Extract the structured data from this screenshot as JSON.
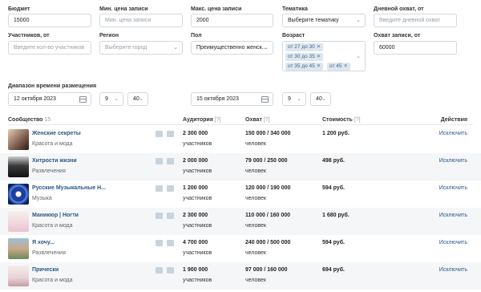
{
  "filters": {
    "budget": {
      "label": "Бюджет",
      "value": "15000"
    },
    "min_price": {
      "label": "Мин. цена записи",
      "placeholder": "Мин. цена записи"
    },
    "max_price": {
      "label": "Макс. цена записи",
      "value": "2000"
    },
    "topic": {
      "label": "Тематика",
      "value": "Выберите тематику"
    },
    "daily_reach": {
      "label": "Дневной охват, от",
      "placeholder": "Введите дневной охват"
    },
    "members": {
      "label": "Участников, от",
      "placeholder": "Введите кол-во участников"
    },
    "region": {
      "label": "Регион",
      "value": "Выберите город"
    },
    "gender": {
      "label": "Пол",
      "value": "Преимущественно женск..."
    },
    "age": {
      "label": "Возраст",
      "tags": [
        "от 27 до 30",
        "от 30 до 35",
        "от 35 до 45",
        "от 45"
      ]
    },
    "post_reach": {
      "label": "Охват записи, от",
      "value": "60000"
    }
  },
  "date_range": {
    "label": "Диапазон времени размещения",
    "from_date": "12 октября 2023",
    "from_hour": "9",
    "from_minute": "40",
    "to_date": "15 октября 2023",
    "to_hour": "9",
    "to_minute": "40"
  },
  "table": {
    "headers": {
      "community": "Сообщество",
      "community_count": "15",
      "audience": "Аудитория",
      "reach": "Охват",
      "cost": "Стоимость",
      "help": "[?]",
      "actions": "Действия"
    },
    "rows": [
      {
        "name": "Женские секреты",
        "category": "Красота и мода",
        "audience": "2 300 000",
        "audience_unit": "участников",
        "reach": "150 000 / 340 000",
        "reach_unit": "человек",
        "cost": "1 200 руб.",
        "action": "Исключить"
      },
      {
        "name": "Хитрости жизни",
        "category": "Развлечения",
        "audience": "2 000 000",
        "audience_unit": "участников",
        "reach": "79 000 / 250 000",
        "reach_unit": "человек",
        "cost": "498 руб.",
        "action": "Исключить"
      },
      {
        "name": "Русские Музыкальные Н...",
        "category": "Музыка",
        "audience": "1 200 000",
        "audience_unit": "участников",
        "reach": "120 000 / 190 000",
        "reach_unit": "человек",
        "cost": "594 руб.",
        "action": "Исключить"
      },
      {
        "name": "Маникюр | Ногти",
        "category": "Красота и мода",
        "audience": "2 300 000",
        "audience_unit": "участников",
        "reach": "110 000 / 160 000",
        "reach_unit": "человек",
        "cost": "1 680 руб.",
        "action": "Исключить"
      },
      {
        "name": "Я хочу...",
        "category": "Развлечения",
        "audience": "4 700 000",
        "audience_unit": "участников",
        "reach": "240 000 / 500 000",
        "reach_unit": "человек",
        "cost": "594 руб.",
        "action": "Исключить"
      },
      {
        "name": "Прически",
        "category": "Красота и мода",
        "audience": "1 900 000",
        "audience_unit": "участников",
        "reach": "97 000 / 160 000",
        "reach_unit": "человек",
        "cost": "694 руб.",
        "action": "Исключить"
      }
    ]
  },
  "colors": {
    "link": "#2a5885",
    "tag_bg": "#dee6ef",
    "border": "#d3d9de",
    "row_alt": "#f5f6f8"
  }
}
